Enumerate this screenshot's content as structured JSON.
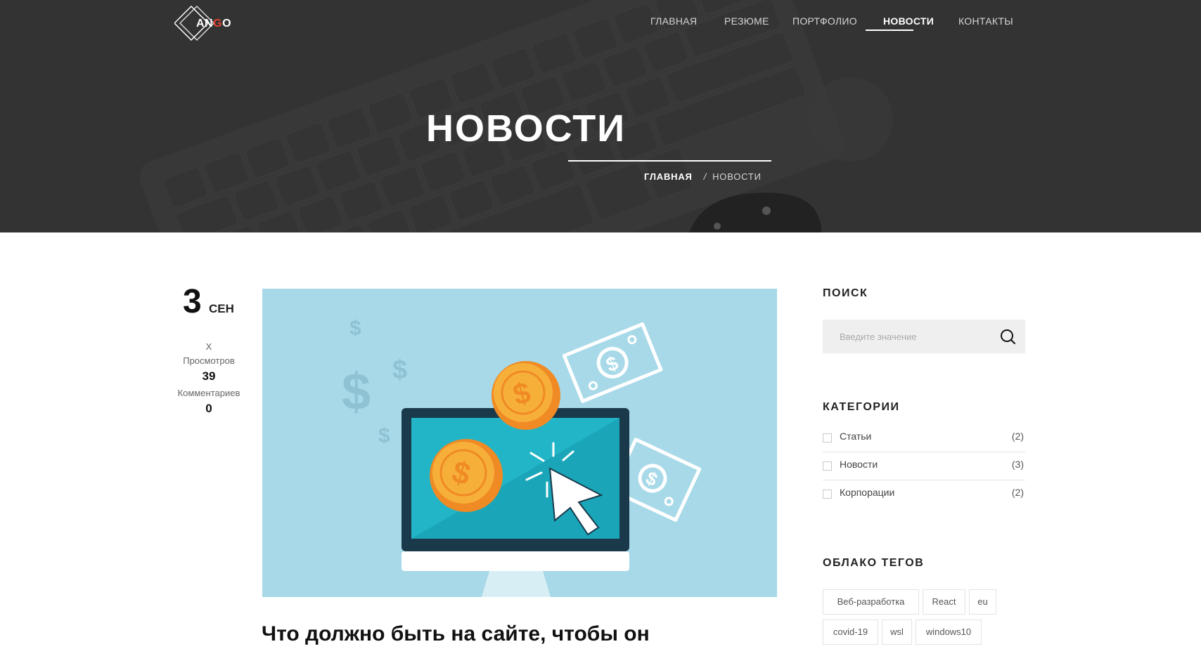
{
  "brand": {
    "logo_text_a": "AN",
    "logo_text_g": "G",
    "logo_text_o": "O"
  },
  "nav": {
    "items": [
      "ГЛАВНАЯ",
      "РЕЗЮМЕ",
      "ПОРТФОЛИО",
      "НОВОСТИ",
      "КОНТАКТЫ"
    ],
    "active": "НОВОСТИ"
  },
  "hero": {
    "title": "НОВОСТИ",
    "breadcrumb": {
      "home": "ГЛАВНАЯ",
      "separator": "/",
      "current": "НОВОСТИ"
    }
  },
  "post": {
    "day": "3",
    "month": "СЕН",
    "author": "X",
    "views_label": "Просмотров",
    "views": "39",
    "comments_label": "Комментариев",
    "comments": "0",
    "title": "Что должно быть на сайте, чтобы он"
  },
  "sidebar": {
    "search": {
      "heading": "ПОИСК",
      "placeholder": "Введите значение",
      "value": ""
    },
    "categories": {
      "heading": "КАТЕГОРИИ",
      "items": [
        {
          "label": "Статьи",
          "count": "(2)"
        },
        {
          "label": "Новости",
          "count": "(3)"
        },
        {
          "label": "Корпорации",
          "count": "(2)"
        }
      ]
    },
    "tags": {
      "heading": "ОБЛАКО ТЕГОВ",
      "items": [
        "Веб-разработка",
        "React",
        "eu",
        "covid-19",
        "wsl",
        "windows10"
      ]
    }
  },
  "colors": {
    "hero_bg": "#333333",
    "accent_logo": "#e8412e",
    "image_bg": "#a7d9e8",
    "search_bg": "#efefef"
  }
}
